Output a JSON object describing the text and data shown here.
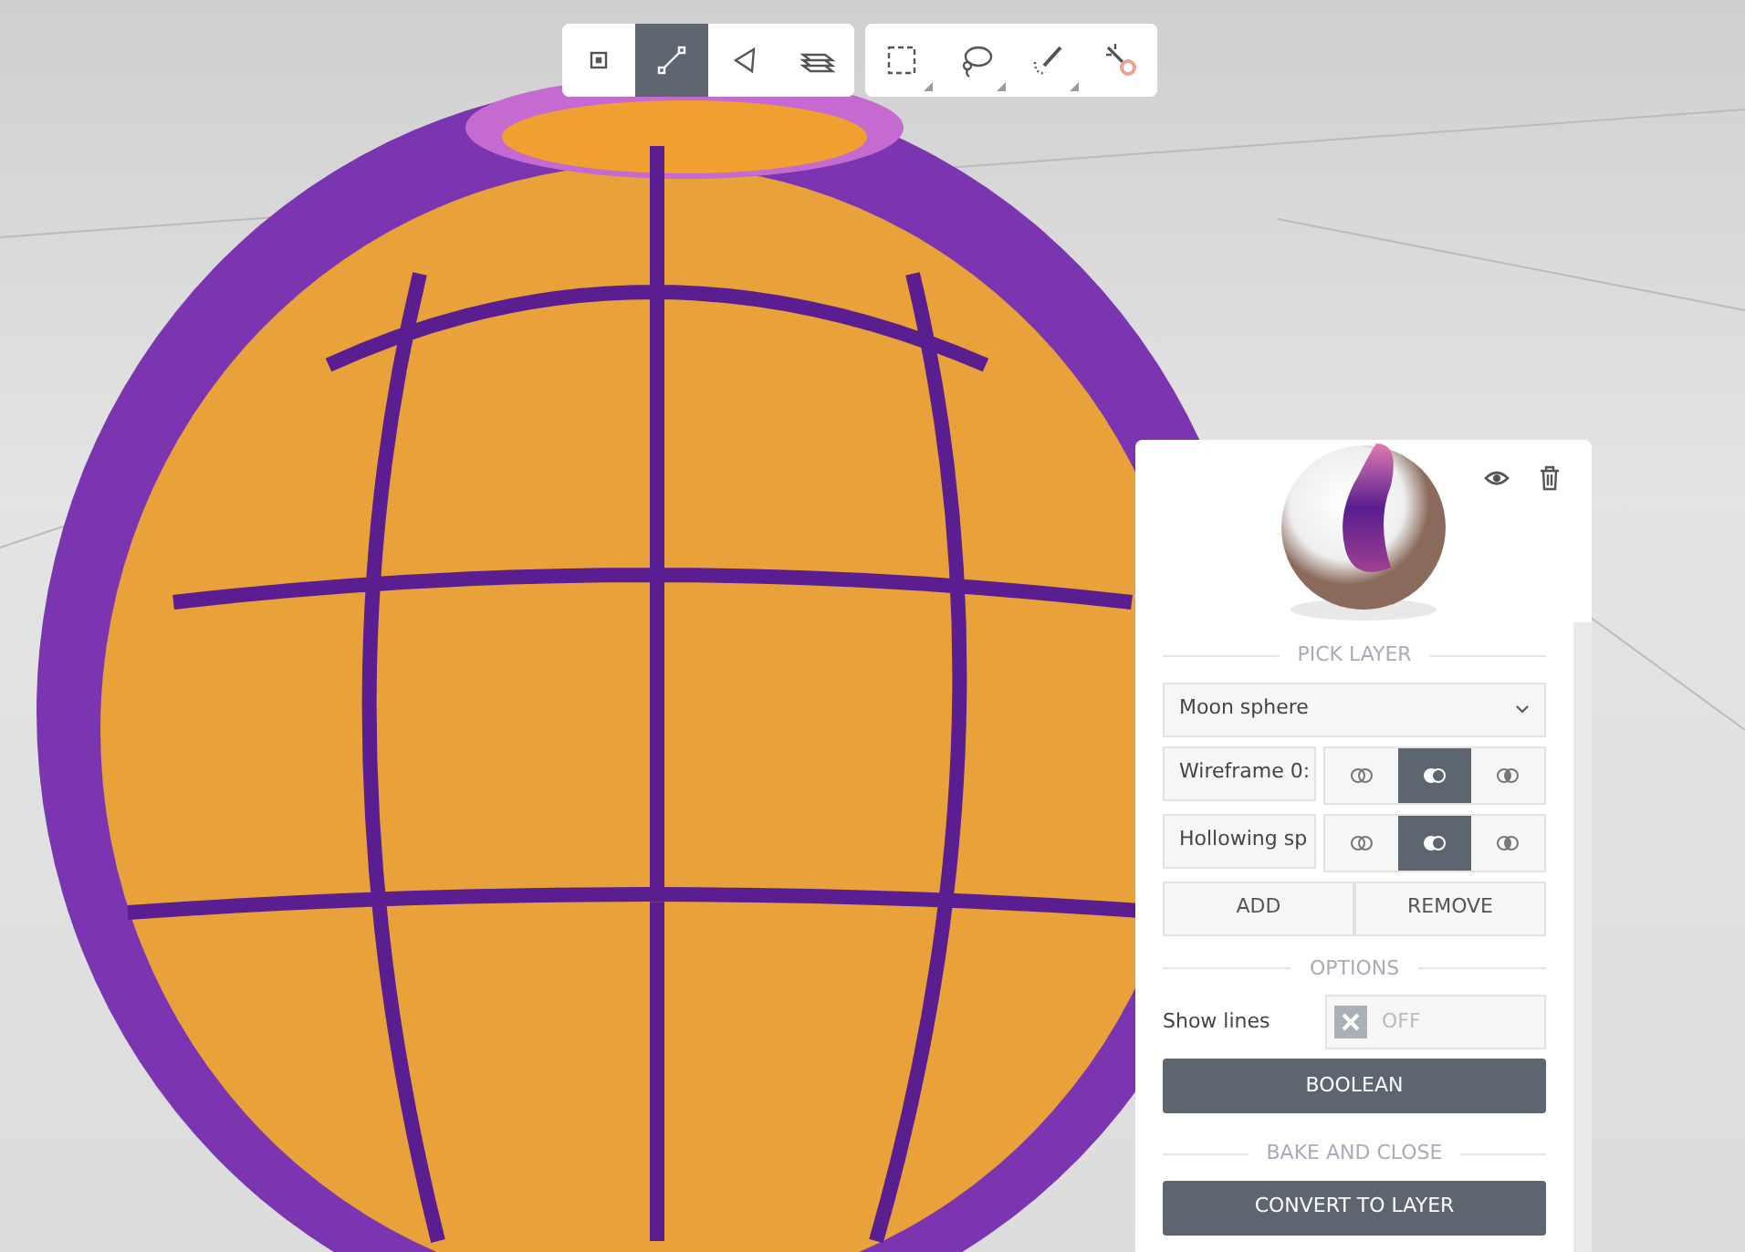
{
  "toolbar": {
    "groups": [
      {
        "tools": [
          {
            "kind": "point",
            "selected": false,
            "submenu": false
          },
          {
            "kind": "segment",
            "selected": true,
            "submenu": false
          },
          {
            "kind": "triangle",
            "selected": false,
            "submenu": false
          },
          {
            "kind": "layers",
            "selected": false,
            "submenu": false
          }
        ]
      },
      {
        "tools": [
          {
            "kind": "rect-select",
            "selected": false,
            "submenu": true
          },
          {
            "kind": "lasso",
            "selected": false,
            "submenu": true
          },
          {
            "kind": "brush",
            "selected": false,
            "submenu": true
          },
          {
            "kind": "wand",
            "selected": false,
            "submenu": false
          }
        ]
      }
    ]
  },
  "panel": {
    "pick_layer": {
      "heading": "PICK LAYER",
      "dropdown": "Moon sphere",
      "layers": [
        {
          "name": "Wireframe 0:",
          "modes": [
            {
              "kind": "union",
              "selected": false
            },
            {
              "kind": "difference",
              "selected": true
            },
            {
              "kind": "intersection",
              "selected": false
            }
          ]
        },
        {
          "name": "Hollowing sp",
          "modes": [
            {
              "kind": "union",
              "selected": false
            },
            {
              "kind": "difference",
              "selected": true
            },
            {
              "kind": "intersection",
              "selected": false
            }
          ]
        }
      ],
      "buttons": [
        "ADD",
        "REMOVE"
      ]
    },
    "options": {
      "heading": "OPTIONS",
      "show_lines": {
        "label": "Show lines",
        "on": false,
        "state_text": "OFF"
      },
      "button": "BOOLEAN"
    },
    "bake": {
      "heading": "BAKE AND CLOSE",
      "button": "CONVERT TO LAYER"
    }
  }
}
